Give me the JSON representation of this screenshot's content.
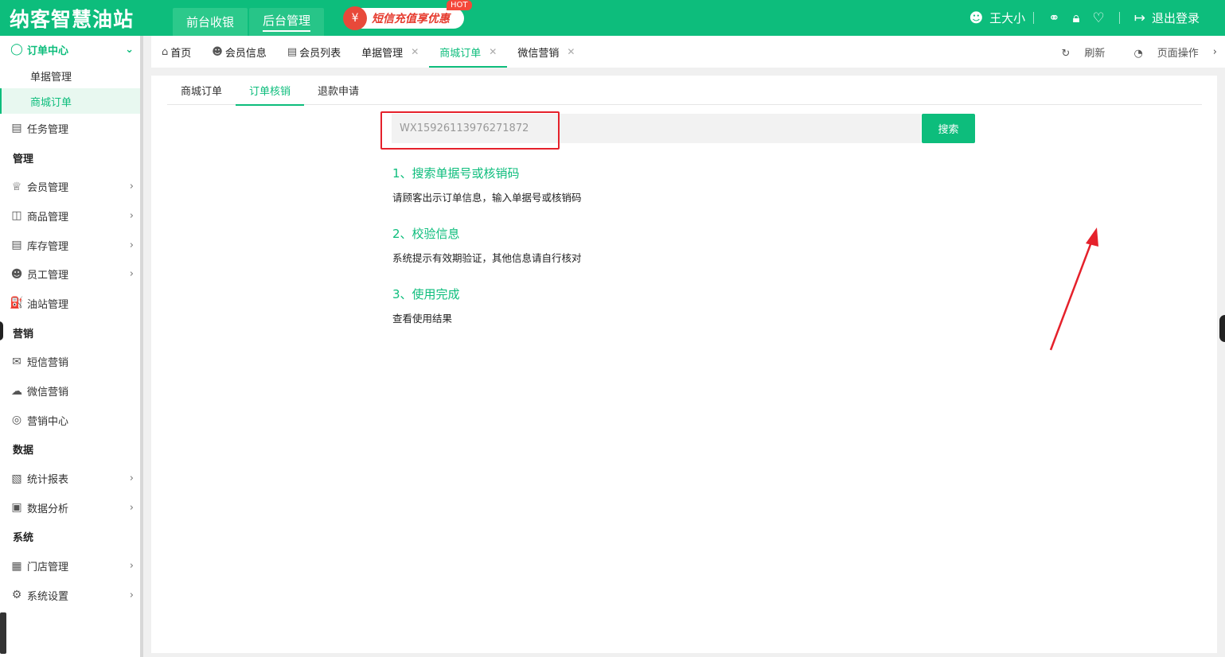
{
  "header": {
    "logo": "纳客智慧油站",
    "tabs": [
      {
        "label": "前台收银"
      },
      {
        "label": "后台管理"
      }
    ],
    "promo": {
      "text": "短信充值享优惠",
      "badge": "HOT"
    },
    "user": "王大小",
    "logout": "退出登录"
  },
  "sidebar": {
    "order_center": "订单中心",
    "order_sub": [
      "单据管理",
      "商城订单"
    ],
    "task": "任务管理",
    "sections": {
      "manage": "管理",
      "marketing": "营销",
      "data": "数据",
      "system": "系统"
    },
    "manage_items": [
      "会员管理",
      "商品管理",
      "库存管理",
      "员工管理",
      "油站管理"
    ],
    "marketing_items": [
      "短信营销",
      "微信营销",
      "营销中心"
    ],
    "data_items": [
      "统计报表",
      "数据分析"
    ],
    "system_items": [
      "门店管理",
      "系统设置"
    ]
  },
  "pagetabs": {
    "items": [
      "首页",
      "会员信息",
      "会员列表",
      "单据管理",
      "商城订单",
      "微信营销"
    ],
    "refresh": "刷新",
    "page_ops": "页面操作"
  },
  "subtabs": [
    "商城订单",
    "订单核销",
    "退款申请"
  ],
  "search": {
    "value": "WX15926113976271872",
    "button": "搜索"
  },
  "steps": [
    {
      "title": "1、搜索单据号或核销码",
      "desc": "请顾客出示订单信息，输入单据号或核销码"
    },
    {
      "title": "2、校验信息",
      "desc": "系统提示有效期验证，其他信息请自行核对"
    },
    {
      "title": "3、使用完成",
      "desc": "查看使用结果"
    }
  ],
  "colors": {
    "brand": "#0dbd7c",
    "highlight": "#e5212b"
  }
}
